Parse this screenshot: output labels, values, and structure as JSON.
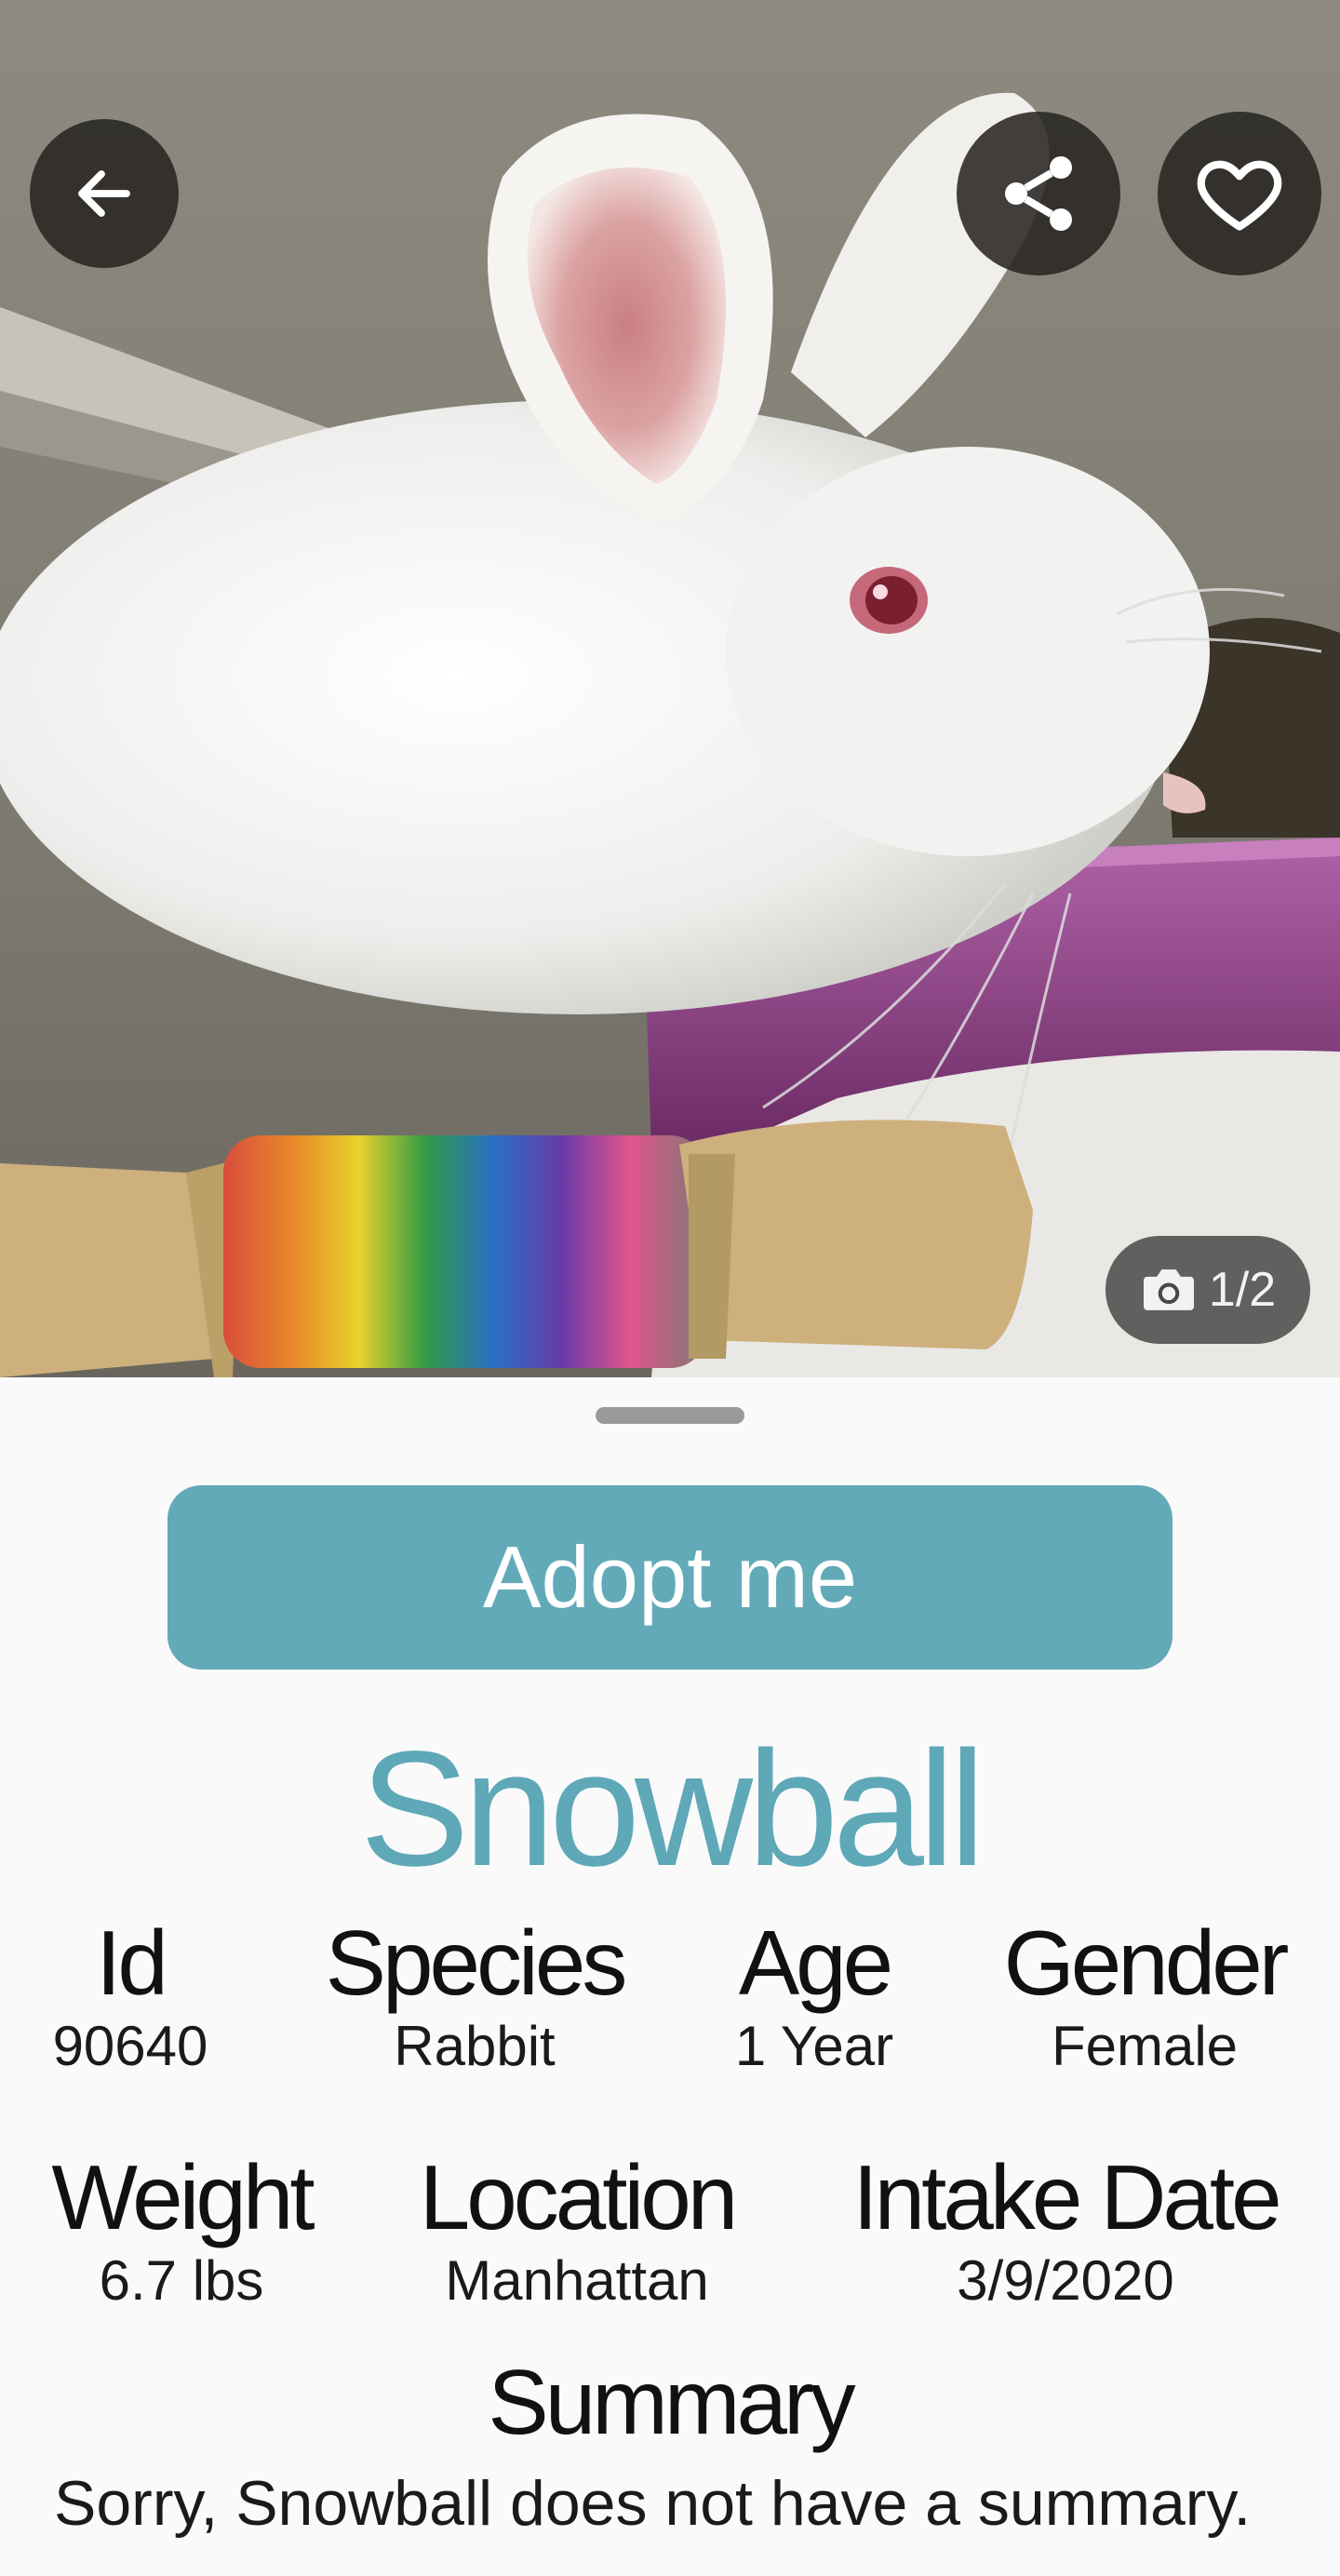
{
  "photo": {
    "description_icon": "camera-icon",
    "counter": "1/2"
  },
  "header": {
    "back_icon": "arrow-left-icon",
    "share_icon": "share-icon",
    "favorite_icon": "heart-icon"
  },
  "actions": {
    "adopt_label": "Adopt me"
  },
  "pet": {
    "name": "Snowball"
  },
  "stats": {
    "row1": [
      {
        "label": "Id",
        "value": "90640"
      },
      {
        "label": "Species",
        "value": "Rabbit"
      },
      {
        "label": "Age",
        "value": "1 Year"
      },
      {
        "label": "Gender",
        "value": "Female"
      }
    ],
    "row2": [
      {
        "label": "Weight",
        "value": "6.7 lbs"
      },
      {
        "label": "Location",
        "value": "Manhattan"
      },
      {
        "label": "Intake Date",
        "value": "3/9/2020"
      }
    ]
  },
  "summary": {
    "title": "Summary",
    "text": "Sorry, Snowball does not have a summary."
  },
  "colors": {
    "accent": "#62aab8",
    "name": "#5ea8b8",
    "sheet_bg": "#fafafa"
  }
}
